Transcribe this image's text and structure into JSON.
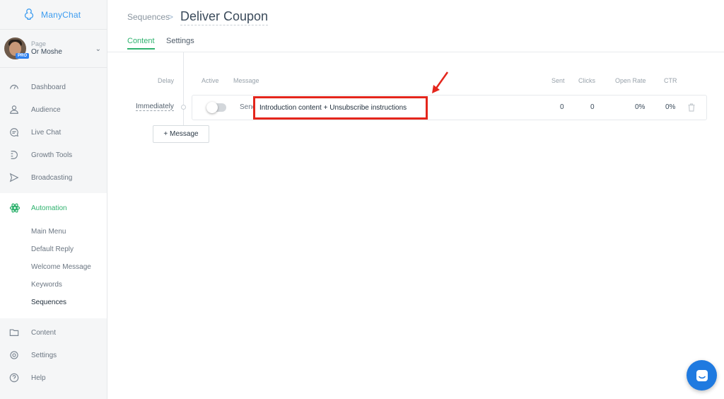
{
  "app": {
    "name": "ManyChat"
  },
  "page": {
    "label": "Page",
    "name": "Or Moshe",
    "badge": "PRO"
  },
  "nav": {
    "items": [
      {
        "label": "Dashboard",
        "icon": "dashboard-icon"
      },
      {
        "label": "Audience",
        "icon": "audience-icon"
      },
      {
        "label": "Live Chat",
        "icon": "chat-icon"
      },
      {
        "label": "Growth Tools",
        "icon": "growth-icon"
      },
      {
        "label": "Broadcasting",
        "icon": "broadcast-icon"
      }
    ],
    "automation": {
      "label": "Automation",
      "icon": "automation-icon",
      "sub": [
        "Main Menu",
        "Default Reply",
        "Welcome Message",
        "Keywords",
        "Sequences"
      ],
      "active": "Sequences"
    },
    "bottom": [
      {
        "label": "Content",
        "icon": "folder-icon"
      },
      {
        "label": "Settings",
        "icon": "gear-icon"
      },
      {
        "label": "Help",
        "icon": "help-icon"
      }
    ]
  },
  "header": {
    "breadcrumb": "Sequences",
    "separator": ">",
    "title": "Deliver Coupon",
    "tabs": [
      "Content",
      "Settings"
    ],
    "active_tab": "Content"
  },
  "table": {
    "headers": {
      "delay": "Delay",
      "active": "Active",
      "message": "Message",
      "sent": "Sent",
      "clicks": "Clicks",
      "open_rate": "Open Rate",
      "ctr": "CTR"
    },
    "rows": [
      {
        "delay": "Immediately",
        "active": false,
        "message_peek": "Send",
        "message": "Introduction content + Unsubscribe instructions",
        "sent": "0",
        "clicks": "0",
        "open_rate": "0%",
        "ctr": "0%"
      }
    ]
  },
  "add_message_label": "+ Message",
  "colors": {
    "accent_green": "#2fb26e",
    "brand_blue": "#3c9cf0",
    "highlight_red": "#e4261c",
    "chat_blue": "#1f7ae0"
  }
}
